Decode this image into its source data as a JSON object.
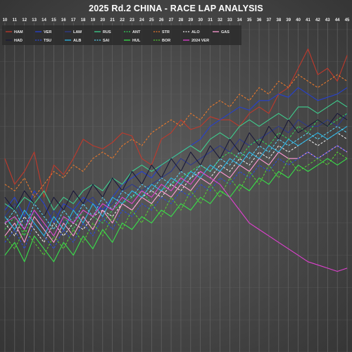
{
  "title": "2025 Rd.2 CHINA - RACE LAP ANALYSIS",
  "colors": {
    "background": "#4a4a4a",
    "grid": "#6a6a6a",
    "legend_bg": "#2b2b2b"
  },
  "chart_data": {
    "type": "line",
    "title": "2025 Rd.2 CHINA - RACE LAP ANALYSIS",
    "xlabel": "",
    "ylabel": "",
    "x_ticks": [
      10,
      11,
      12,
      13,
      14,
      15,
      16,
      17,
      18,
      19,
      20,
      21,
      22,
      23,
      24,
      25,
      26,
      27,
      28,
      29,
      30,
      31,
      32,
      33,
      34,
      35,
      36,
      37,
      38,
      39,
      40,
      41,
      42,
      43,
      44,
      45
    ],
    "xlim": [
      10,
      45.5
    ],
    "ylim": [
      0,
      100
    ],
    "grid": true,
    "legend_placement": "top-left",
    "series": [
      {
        "name": "HAM",
        "color": "#c0392b",
        "dash": false,
        "start": 10,
        "values": [
          60,
          52,
          56,
          62,
          48,
          58,
          55,
          60,
          66,
          64,
          63,
          65,
          68,
          67,
          60,
          58,
          66,
          68,
          72,
          69,
          70,
          73,
          72,
          72,
          70,
          74,
          76,
          74,
          80,
          82,
          88,
          94,
          86,
          88,
          84,
          92
        ]
      },
      {
        "name": "VER",
        "color": "#2540d0",
        "dash": false,
        "start": 10,
        "values": [
          44,
          48,
          42,
          50,
          46,
          40,
          46,
          44,
          48,
          46,
          44,
          48,
          52,
          54,
          56,
          54,
          58,
          60,
          62,
          64,
          66,
          70,
          72,
          74,
          76,
          75,
          78,
          78,
          80,
          79,
          82,
          80,
          78,
          79,
          80,
          82
        ]
      },
      {
        "name": "LAW",
        "color": "#2e3a8c",
        "dash": false,
        "start": 10,
        "values": [
          42,
          46,
          40,
          44,
          38,
          44,
          40,
          42,
          46,
          48,
          44,
          46,
          50,
          52,
          50,
          52,
          54,
          56,
          60,
          58,
          60,
          62,
          64,
          62,
          66,
          64,
          66,
          68,
          70,
          68,
          72,
          70,
          70,
          72,
          70,
          74
        ]
      },
      {
        "name": "RUS",
        "color": "#3ecf8e",
        "dash": false,
        "start": 10,
        "values": [
          46,
          44,
          48,
          46,
          50,
          44,
          48,
          46,
          50,
          52,
          50,
          54,
          52,
          56,
          58,
          56,
          58,
          60,
          62,
          64,
          62,
          66,
          68,
          66,
          70,
          72,
          70,
          72,
          74,
          72,
          76,
          76,
          74,
          76,
          78,
          76
        ]
      },
      {
        "name": "ANT",
        "color": "#35d05a",
        "dash": true,
        "start": 10,
        "values": [
          38,
          42,
          36,
          44,
          40,
          36,
          42,
          38,
          44,
          42,
          40,
          44,
          46,
          48,
          50,
          46,
          50,
          52,
          54,
          56,
          58,
          56,
          60,
          62,
          60,
          64,
          66,
          64,
          68,
          66,
          70,
          68,
          72,
          70,
          72,
          74
        ]
      },
      {
        "name": "STR",
        "color": "#e6782d",
        "dash": true,
        "start": 10,
        "values": [
          52,
          50,
          54,
          48,
          52,
          56,
          54,
          58,
          56,
          60,
          62,
          60,
          64,
          66,
          64,
          68,
          70,
          72,
          70,
          74,
          72,
          76,
          78,
          76,
          80,
          78,
          82,
          80,
          84,
          82,
          86,
          84,
          82,
          84,
          86,
          84
        ]
      },
      {
        "name": "ALO",
        "color": "#e8e8e8",
        "dash": true,
        "start": 10,
        "values": [
          40,
          36,
          42,
          38,
          34,
          40,
          36,
          40,
          38,
          42,
          44,
          42,
          46,
          44,
          48,
          50,
          48,
          52,
          50,
          54,
          56,
          54,
          58,
          56,
          60,
          58,
          62,
          60,
          64,
          62,
          64,
          66,
          64,
          66,
          68,
          66
        ]
      },
      {
        "name": "GAS",
        "color": "#ff9ad5",
        "dash": false,
        "start": 10,
        "values": [
          36,
          40,
          34,
          42,
          38,
          34,
          40,
          36,
          42,
          38,
          44,
          40,
          46,
          44,
          48,
          46,
          50,
          48,
          52,
          50,
          54,
          52,
          56,
          54,
          58,
          56,
          60,
          58,
          62,
          60,
          60,
          62,
          60,
          62,
          64,
          62
        ]
      },
      {
        "name": "HAD",
        "color": "#1a1a3a",
        "dash": false,
        "start": 10,
        "values": [
          48,
          44,
          50,
          46,
          42,
          48,
          44,
          50,
          46,
          52,
          48,
          54,
          50,
          56,
          52,
          58,
          54,
          60,
          56,
          62,
          58,
          64,
          60,
          66,
          62,
          68,
          64,
          70,
          66,
          72,
          68,
          70,
          72,
          70,
          74,
          72
        ]
      },
      {
        "name": "TSU",
        "color": "#2a4ad8",
        "dash": true,
        "start": 10,
        "values": [
          34,
          38,
          32,
          40,
          36,
          32,
          38,
          34,
          40,
          36,
          42,
          38,
          44,
          42,
          46,
          44,
          48,
          46,
          50,
          48,
          52,
          50,
          54,
          52,
          56,
          54,
          58,
          56,
          60,
          58,
          60,
          62,
          60,
          62,
          64,
          62
        ]
      },
      {
        "name": "ALB",
        "color": "#2bb7e8",
        "dash": false,
        "start": 10,
        "values": [
          42,
          38,
          44,
          40,
          36,
          42,
          38,
          44,
          40,
          46,
          42,
          48,
          46,
          50,
          48,
          52,
          50,
          54,
          52,
          56,
          54,
          58,
          56,
          60,
          58,
          62,
          60,
          64,
          62,
          66,
          64,
          66,
          68,
          66,
          68,
          70
        ]
      },
      {
        "name": "SAI",
        "color": "#5ad0f0",
        "dash": true,
        "start": 10,
        "values": [
          40,
          44,
          38,
          46,
          42,
          38,
          44,
          40,
          46,
          42,
          48,
          44,
          50,
          48,
          52,
          50,
          54,
          52,
          56,
          54,
          58,
          56,
          60,
          58,
          62,
          60,
          64,
          62,
          66,
          64,
          66,
          68,
          66,
          68,
          70,
          68
        ]
      },
      {
        "name": "HUL",
        "color": "#38e04a",
        "dash": false,
        "start": 10,
        "values": [
          30,
          34,
          28,
          36,
          32,
          28,
          34,
          30,
          36,
          32,
          38,
          34,
          40,
          38,
          42,
          40,
          44,
          42,
          46,
          44,
          48,
          46,
          50,
          48,
          52,
          50,
          54,
          52,
          56,
          54,
          58,
          56,
          58,
          60,
          58,
          60
        ]
      },
      {
        "name": "BOR",
        "color": "#55cc33",
        "dash": true,
        "start": 10,
        "values": [
          36,
          32,
          38,
          34,
          30,
          36,
          32,
          38,
          34,
          40,
          36,
          42,
          38,
          44,
          40,
          46,
          42,
          48,
          44,
          50,
          46,
          52,
          48,
          54,
          50,
          56,
          52,
          58,
          54,
          60,
          56,
          58,
          60,
          58,
          62,
          60
        ]
      },
      {
        "name": "2024 VER",
        "color": "#e040d0",
        "dash": false,
        "start": 10,
        "values": [
          40,
          42,
          38,
          44,
          40,
          36,
          42,
          40,
          44,
          42,
          46,
          44,
          48,
          46,
          50,
          48,
          52,
          50,
          54,
          52,
          56,
          54,
          52,
          48,
          44,
          40,
          38,
          36,
          34,
          32,
          30,
          28,
          27,
          26,
          25,
          26
        ]
      }
    ]
  }
}
